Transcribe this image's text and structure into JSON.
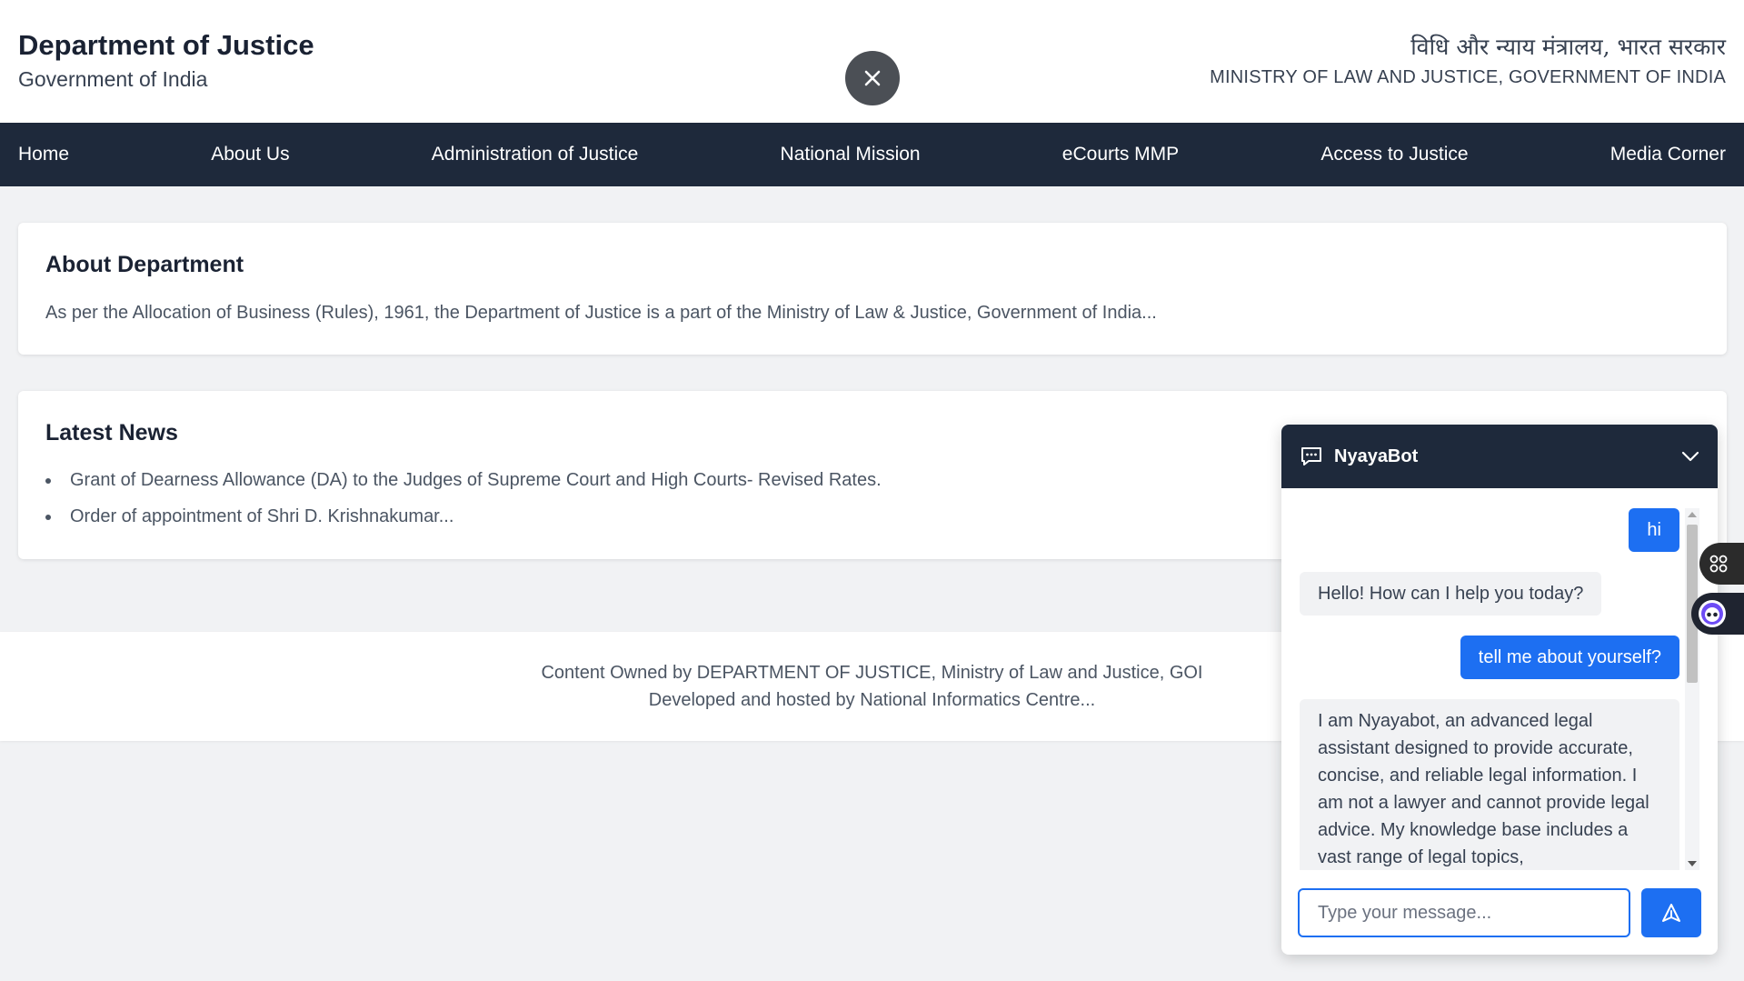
{
  "header": {
    "title": "Department of Justice",
    "subtitle": "Government of India",
    "ministry_hindi": "विधि और न्याय मंत्रालय, भारत सरकार",
    "ministry_english": "MINISTRY OF LAW AND JUSTICE, GOVERNMENT OF INDIA",
    "close_icon": "close-icon"
  },
  "nav": {
    "items": [
      {
        "label": "Home"
      },
      {
        "label": "About Us"
      },
      {
        "label": "Administration of Justice"
      },
      {
        "label": "National Mission"
      },
      {
        "label": "eCourts MMP"
      },
      {
        "label": "Access to Justice"
      },
      {
        "label": "Media Corner"
      }
    ]
  },
  "about": {
    "title": "About Department",
    "text": "As per the Allocation of Business (Rules), 1961, the Department of Justice is a part of the Ministry of Law & Justice, Government of India..."
  },
  "news": {
    "title": "Latest News",
    "items": [
      "Grant of Dearness Allowance (DA) to the Judges of Supreme Court and High Courts- Revised Rates.",
      "Order of appointment of Shri D. Krishnakumar..."
    ]
  },
  "footer": {
    "line1": "Content Owned by DEPARTMENT OF JUSTICE, Ministry of Law and Justice, GOI",
    "line2": "Developed and hosted by National Informatics Centre..."
  },
  "chat": {
    "title": "NyayaBot",
    "messages": [
      {
        "from": "user",
        "text": "hi"
      },
      {
        "from": "bot",
        "text": "Hello! How can I help you today?"
      },
      {
        "from": "user",
        "text": "tell me about yourself?"
      },
      {
        "from": "bot",
        "text": "I am Nyayabot, an advanced legal assistant designed to provide accurate, concise, and reliable legal information. I am not a lawyer and cannot provide legal advice. My knowledge base includes a vast range of legal topics,"
      }
    ],
    "input_placeholder": "Type your message...",
    "input_value": "",
    "icons": {
      "chat": "chat-bubble-icon",
      "collapse": "chevron-down-icon",
      "send": "send-icon"
    }
  },
  "colors": {
    "nav_bg": "#1e293b",
    "accent": "#1d6ff2",
    "close_btn": "#4b4f55",
    "page_bg": "#f1f2f4"
  }
}
